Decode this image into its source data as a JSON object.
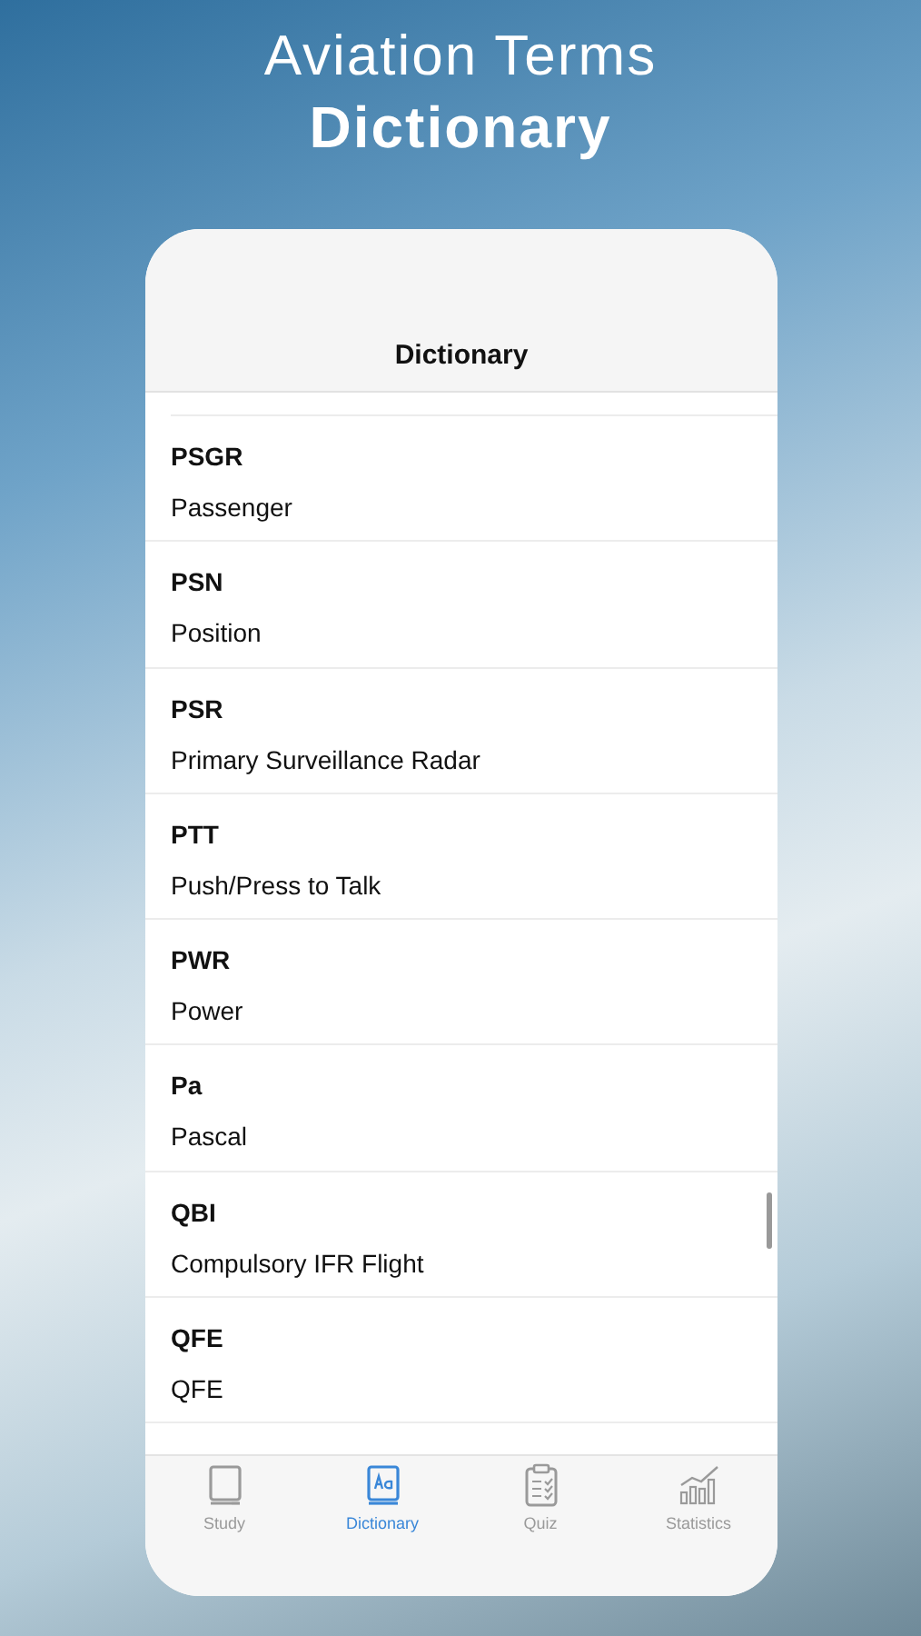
{
  "headline": {
    "line_1": "Aviation Terms",
    "line_2": "Dictionary"
  },
  "nav_bar": {
    "title": "Dictionary"
  },
  "entries": [
    {
      "term": "PSGR",
      "definition": "Passenger"
    },
    {
      "term": "PSN",
      "definition": "Position"
    },
    {
      "term": "PSR",
      "definition": "Primary Surveillance Radar"
    },
    {
      "term": "PTT",
      "definition": "Push/Press to Talk"
    },
    {
      "term": "PWR",
      "definition": "Power"
    },
    {
      "term": "Pa",
      "definition": "Pascal"
    },
    {
      "term": "QBI",
      "definition": "Compulsory IFR Flight"
    },
    {
      "term": "QFE",
      "definition": "QFE"
    }
  ],
  "tab_bar": [
    {
      "kind": "book",
      "label": "Study",
      "selected": false
    },
    {
      "kind": "dictionary",
      "label": "Dictionary",
      "selected": true
    },
    {
      "kind": "clipboard",
      "label": "Quiz",
      "selected": false
    },
    {
      "kind": "chart",
      "label": "Statistics",
      "selected": false
    }
  ]
}
